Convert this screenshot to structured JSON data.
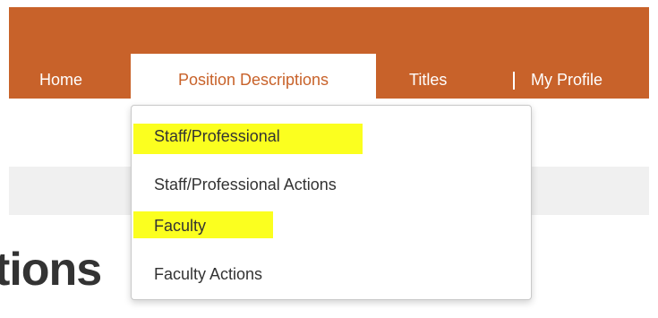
{
  "nav": {
    "home": "Home",
    "position_descriptions": "Position Descriptions",
    "titles": "Titles",
    "my_profile": "My Profile"
  },
  "page": {
    "title_fragment": "tions"
  },
  "dropdown": {
    "items": [
      {
        "label": "Staff/Professional",
        "highlighted": true
      },
      {
        "label": "Staff/Professional Actions",
        "highlighted": false
      },
      {
        "label": "Faculty",
        "highlighted": true
      },
      {
        "label": "Faculty Actions",
        "highlighted": false
      }
    ]
  },
  "colors": {
    "brand": "#c8622a",
    "highlight": "#fbff1f",
    "text": "#333333"
  }
}
